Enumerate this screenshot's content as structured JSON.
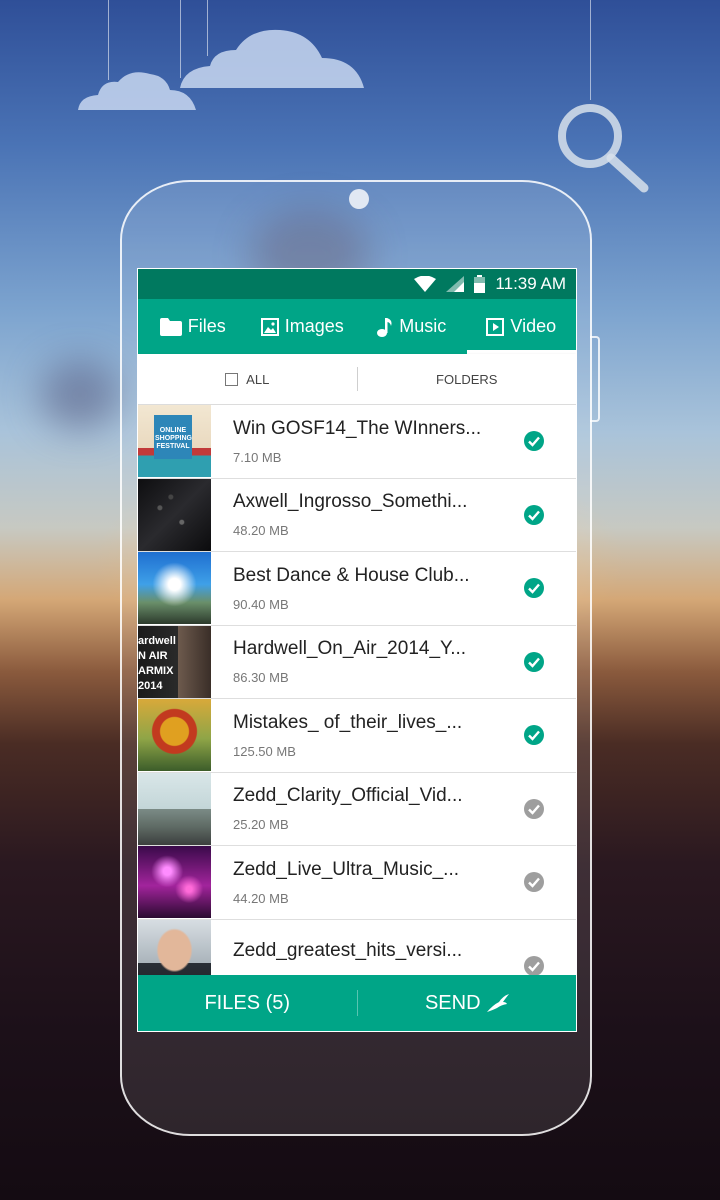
{
  "statusbar": {
    "time": "11:39 AM"
  },
  "tabs": [
    {
      "label": "Files",
      "icon": "folder-icon"
    },
    {
      "label": "Images",
      "icon": "image-icon"
    },
    {
      "label": "Music",
      "icon": "music-note-icon"
    },
    {
      "label": "Video",
      "icon": "video-icon",
      "active": true
    }
  ],
  "filter": {
    "all_label": "ALL",
    "folders_label": "FOLDERS"
  },
  "files": [
    {
      "title": "Win GOSF14_The WInners...",
      "size": "7.10 MB",
      "selected": true,
      "thumb_text": "ONLINE SHOPPING FESTIVAL"
    },
    {
      "title": "Axwell_Ingrosso_Somethi...",
      "size": "48.20 MB",
      "selected": true
    },
    {
      "title": "Best Dance & House Club...",
      "size": "90.40 MB",
      "selected": true
    },
    {
      "title": "Hardwell_On_Air_2014_Y...",
      "size": "86.30 MB",
      "selected": true,
      "thumb_text": "ardwell N AIR ARMIX 2014"
    },
    {
      "title": "Mistakes_ of_their_lives_...",
      "size": "125.50 MB",
      "selected": true
    },
    {
      "title": "Zedd_Clarity_Official_Vid...",
      "size": "25.20 MB",
      "selected": false
    },
    {
      "title": "Zedd_Live_Ultra_Music_...",
      "size": "44.20 MB",
      "selected": false
    },
    {
      "title": "Zedd_greatest_hits_versi...",
      "size": "",
      "selected": false
    }
  ],
  "bottombar": {
    "files_label": "FILES (5)",
    "send_label": "SEND"
  },
  "colors": {
    "accent": "#00a587",
    "accent_dark": "#00795f",
    "check_on": "#00a587",
    "check_off": "#9e9e9e"
  }
}
